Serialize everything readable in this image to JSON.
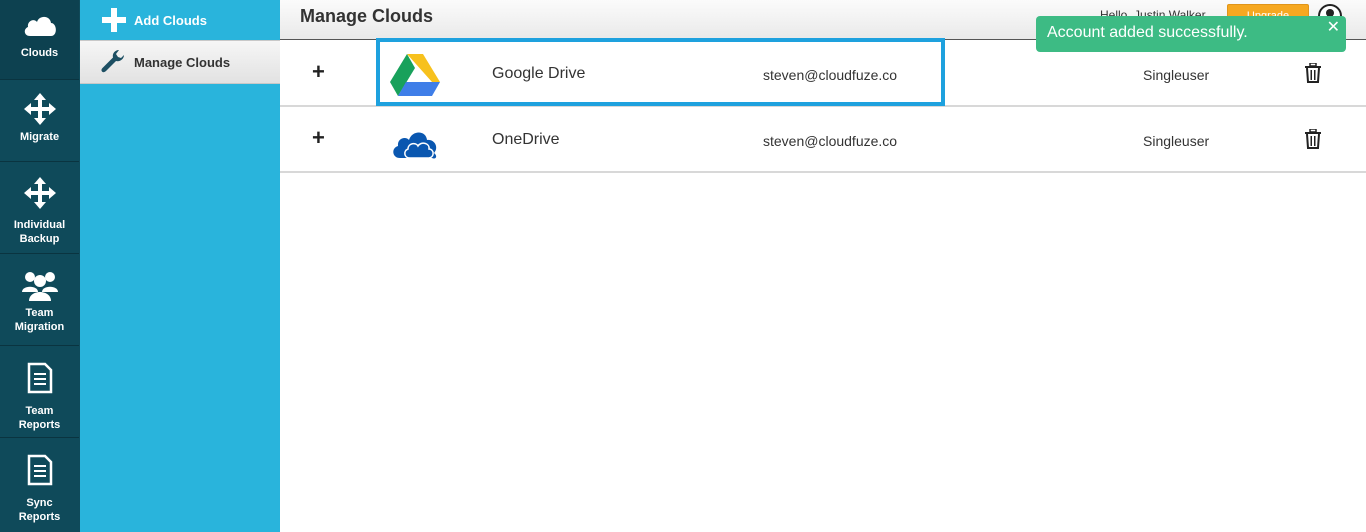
{
  "rail": {
    "items": [
      {
        "label": "Clouds",
        "icon": "cloud-icon"
      },
      {
        "label": "Migrate",
        "icon": "move-arrows-icon"
      },
      {
        "label": "Individual Backup",
        "icon": "move-arrows-icon"
      },
      {
        "label": "Team Migration",
        "icon": "users-icon"
      },
      {
        "label": "Team Reports",
        "icon": "document-icon"
      },
      {
        "label": "Sync Reports",
        "icon": "document-icon"
      }
    ]
  },
  "subnav": {
    "add_clouds": "Add Clouds",
    "manage_clouds": "Manage Clouds"
  },
  "header": {
    "title": "Manage Clouds",
    "greeting": "Hello, Justin Walker",
    "upgrade_label": "Upgrade"
  },
  "toast": {
    "message": "Account added successfully.",
    "close": "✕"
  },
  "clouds": [
    {
      "expand": "+",
      "name": "Google Drive",
      "email": "steven@cloudfuze.co",
      "type": "Singleuser",
      "logo": "google-drive-icon"
    },
    {
      "expand": "+",
      "name": "OneDrive",
      "email": "steven@cloudfuze.co",
      "type": "Singleuser",
      "logo": "onedrive-icon"
    }
  ],
  "colors": {
    "rail_bg": "#0f4a5a",
    "subnav_bg": "#29b4dc",
    "highlight": "#1ea1de",
    "toast_bg": "#3dbb84",
    "upgrade_bg": "#f6a821"
  }
}
